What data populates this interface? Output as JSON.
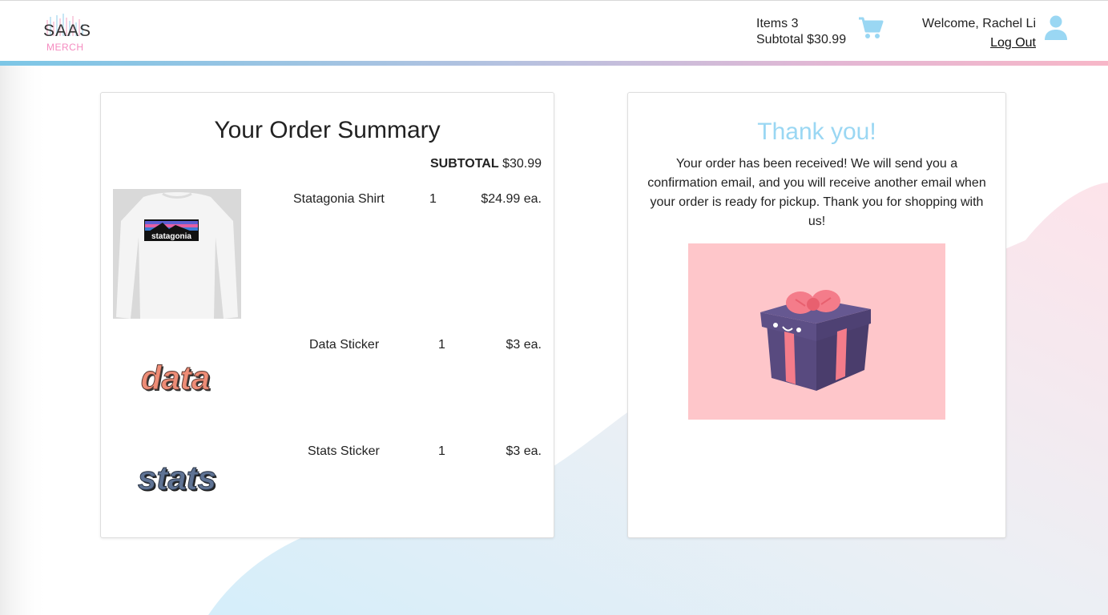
{
  "header": {
    "logo": {
      "word": "SAAS",
      "sub": "MERCH"
    },
    "cart": {
      "items_label": "Items 3",
      "subtotal_label": "Subtotal $30.99"
    },
    "user": {
      "welcome": "Welcome, Rachel Li",
      "logout": "Log Out"
    }
  },
  "order": {
    "title": "Your Order Summary",
    "subtotal_label": "SUBTOTAL",
    "subtotal_value": "$30.99",
    "items": [
      {
        "name": "Statagonia Shirt",
        "qty": "1",
        "price": "$24.99 ea.",
        "image_text": "statagonia"
      },
      {
        "name": "Data Sticker",
        "qty": "1",
        "price": "$3 ea.",
        "image_text": "data"
      },
      {
        "name": "Stats Sticker",
        "qty": "1",
        "price": "$3 ea.",
        "image_text": "stats"
      }
    ]
  },
  "confirmation": {
    "title": "Thank you!",
    "message": "Your order has been received! We will send you a confirmation email, and you will receive another email when your order is ready for pickup. Thank you for shopping with us!"
  },
  "colors": {
    "accent_blue": "#9ad7f3",
    "accent_pink": "#f7b7c8",
    "gift_bg": "#fec6ca",
    "gift_box": "#584a7f"
  },
  "icons": [
    "cart-icon",
    "user-icon",
    "gift-box-illustration"
  ]
}
